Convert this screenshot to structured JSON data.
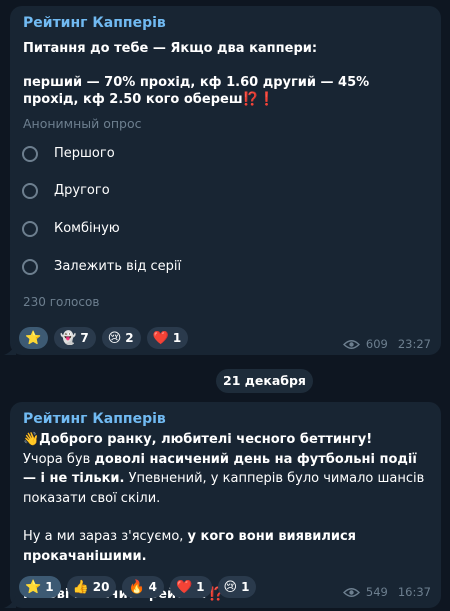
{
  "message1": {
    "channel_name": "Рейтинг Капперів",
    "poll_question_icon": "❗",
    "poll_question": "Питання до тебе — Якщо два каппери:\n\nперший — 70% прохід, кф 1.60 другий — 45% прохід, кф 2.50 кого обереш⁉️❗",
    "poll_type": "Анонимный опрос",
    "options": [
      "Першого",
      "Другого",
      "Комбіную",
      "Залежить від серії"
    ],
    "votes": "230 голосов",
    "reactions": [
      {
        "emoji": "⭐",
        "count": ""
      },
      {
        "emoji": "👻",
        "count": "7"
      },
      {
        "emoji": "😢",
        "count": "2"
      },
      {
        "emoji": "❤️",
        "count": "1"
      }
    ],
    "views": "609",
    "time": "23:27"
  },
  "date_separator": "21 декабря",
  "message2": {
    "channel_name": "Рейтинг Капперів",
    "greeting": "👋Доброго ранку, любителі чесного беттингу!",
    "para1_a": "Учора був ",
    "para1_b": "доволі насичений день на футбольні події — і не тільки.",
    "para1_c": " Упевнений, у капперів було чимало шансів показати свої скіли.",
    "para2_a": "Ну а ми зараз з'ясуємо, ",
    "para2_b": "у кого вони виявилися прокачанішими.",
    "para3": "Готові побачити рейтинг⁉️",
    "reactions": [
      {
        "emoji": "⭐",
        "count": "1"
      },
      {
        "emoji": "👍",
        "count": "20"
      },
      {
        "emoji": "🔥",
        "count": "4"
      },
      {
        "emoji": "❤️",
        "count": "1"
      },
      {
        "emoji": "😢",
        "count": "1"
      }
    ],
    "views": "549",
    "time": "16:37"
  },
  "colors": {
    "background": "#0e1621",
    "bubble": "#182533",
    "channel_name": "#71baf2",
    "muted": "#6d7f8f"
  }
}
